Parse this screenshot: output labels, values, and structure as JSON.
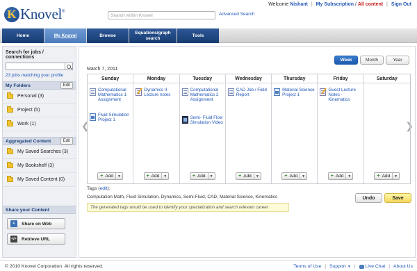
{
  "header": {
    "logo_mark": "K",
    "logo_text": "Knovel",
    "logo_registered": "®",
    "search_placeholder": "Search within Knovel",
    "advanced_search": "Advanced Search",
    "welcome": "Welcome",
    "user_name": "Nishant",
    "my_subscription": "My Subscription",
    "all_content": "All content",
    "sign_out": "Sign Out",
    "separator": "|",
    "separator_slash": "/"
  },
  "nav": {
    "tabs": [
      {
        "label": "Home",
        "active": false
      },
      {
        "label": "My Knovel",
        "active": true
      },
      {
        "label": "Browse",
        "active": false
      },
      {
        "label": "Equations/graph search",
        "active": false
      },
      {
        "label": "Tools",
        "active": false
      }
    ]
  },
  "sidebar": {
    "jobs_title": "Search for jobs / connections",
    "jobs_count": "23 jobs matching your profile",
    "folders_title": "My Folders",
    "edit": "Edit",
    "folders": [
      {
        "label": "Personal (3)"
      },
      {
        "label": "Project (5)"
      },
      {
        "label": "Work (1)"
      }
    ],
    "aggregated_title": "Aggregated Content",
    "aggregated": [
      {
        "label": "My Saved Searches (3)"
      },
      {
        "label": "My Bookshelf (3)"
      },
      {
        "label": "My Saved Content (0)"
      }
    ],
    "share_title": "Share your Content",
    "share_on_web": "Share on Web",
    "retrieve_url": "Retrieve URL",
    "retrieve_icon_text": "</>"
  },
  "main": {
    "view_tabs": [
      {
        "label": "Week",
        "active": true
      },
      {
        "label": "Month",
        "active": false
      },
      {
        "label": "Year",
        "active": false
      }
    ],
    "date": "March 7, 2011",
    "days": [
      {
        "name": "Sunday",
        "events": [
          {
            "title": "Computational Mathematics 1 Assignment",
            "icon": "document-icon"
          },
          {
            "title": "Fluid Simulation Project 1",
            "icon": "diagram-icon"
          }
        ]
      },
      {
        "name": "Monday",
        "events": [
          {
            "title": "Dynamics II Lecture notes",
            "icon": "pencil-icon"
          }
        ]
      },
      {
        "name": "Tuesday",
        "events": [
          {
            "title": "Computational Mathematics 2 Assignment",
            "icon": "document-icon"
          },
          {
            "title": "Semi- Fluid Flow Simulation Video",
            "icon": "video-icon"
          }
        ]
      },
      {
        "name": "Wednesday",
        "events": [
          {
            "title": "CAD Job / Field Report",
            "icon": "document-icon"
          }
        ]
      },
      {
        "name": "Thursday",
        "events": [
          {
            "title": "Material Science Project 1",
            "icon": "diagram-icon"
          }
        ]
      },
      {
        "name": "Friday",
        "events": [
          {
            "title": "Guest Lecture Notes - Kinematics",
            "icon": "pencil-icon"
          }
        ]
      },
      {
        "name": "Saturday",
        "events": []
      }
    ],
    "add_label": "Add",
    "tags_label": "Tags",
    "tags_edit": "edit",
    "tags_values": "Computation Math, Fluid Simulation, Dynamics, Semi-Fluid, CAD, Material Science, Kinematics",
    "tags_hint": "The generated tags would be used to identify your specialization and search relevant career",
    "undo": "Undo",
    "save": "Save"
  },
  "footer": {
    "copyright": "© 2010 Knovel Corporation. All rights reserved.",
    "terms": "Terms of Use",
    "support": "Support",
    "live_chat": "Live Chat",
    "about_us": "About Us"
  },
  "colors": {
    "nav_blue": "#1d4788",
    "link_blue": "#1f56b8",
    "accent_red": "#c21b17",
    "save_yellow": "#f4d85e"
  }
}
